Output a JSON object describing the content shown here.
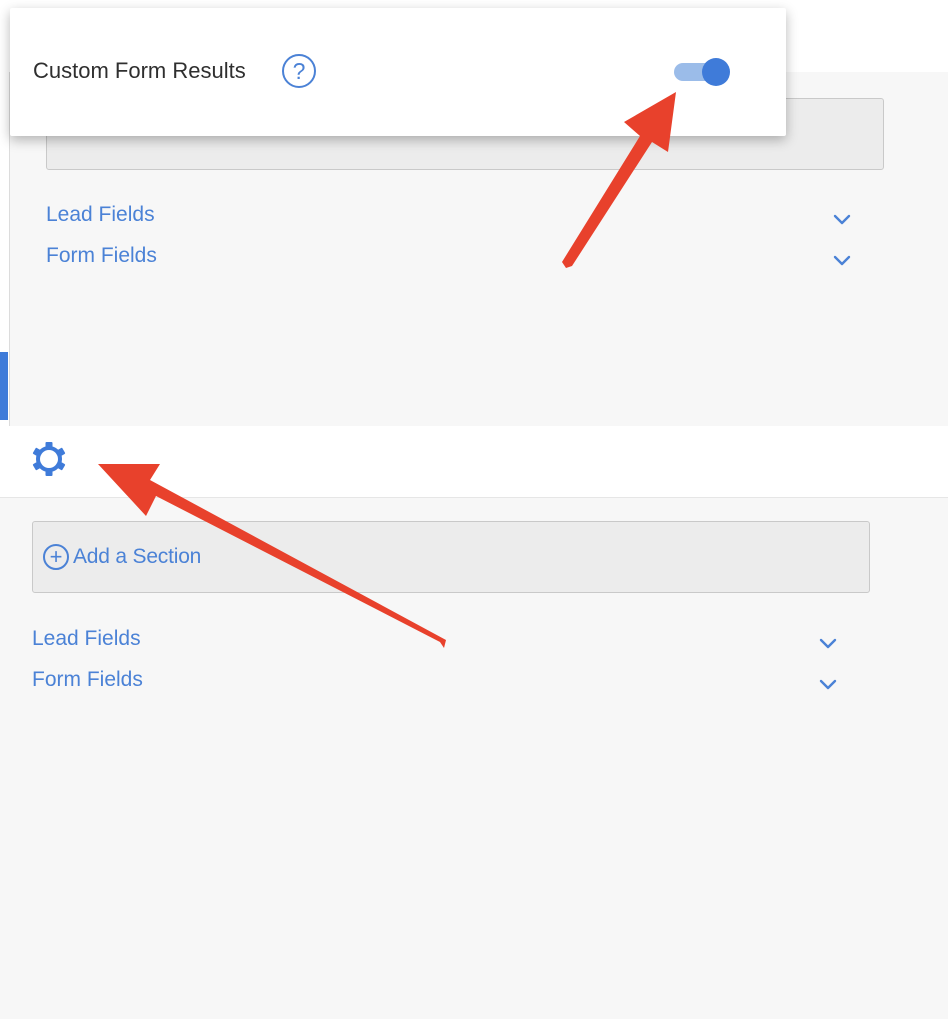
{
  "card": {
    "title": "Custom Form Results",
    "help_glyph": "?",
    "toggle_on": true
  },
  "top_panel": {
    "fields": [
      {
        "label": "Lead Fields"
      },
      {
        "label": "Form Fields"
      }
    ]
  },
  "bottom_panel": {
    "add_section_glyph": "+",
    "add_section_label": "Add a Section",
    "fields": [
      {
        "label": "Lead Fields"
      },
      {
        "label": "Form Fields"
      }
    ]
  },
  "icons": {
    "help": "question-circle-icon",
    "settings": "gear-icon",
    "add": "plus-circle-icon",
    "expand": "chevron-down-icon"
  },
  "colors": {
    "accent": "#3f7bd9",
    "link": "#4b82d6",
    "toggle_track": "#9bbce9",
    "annotation_arrow": "#e8412c",
    "panel_bg": "#f7f7f7"
  }
}
